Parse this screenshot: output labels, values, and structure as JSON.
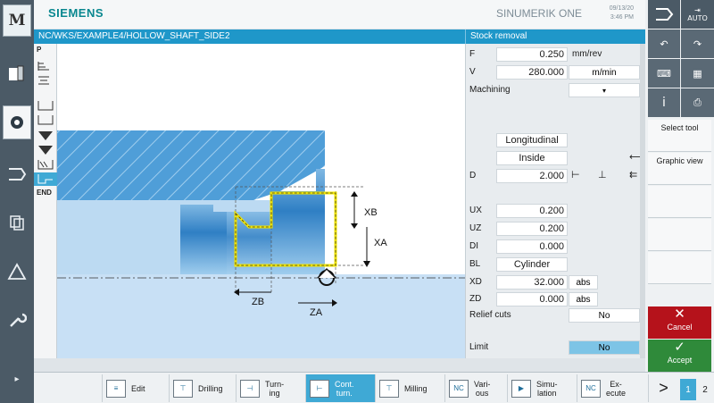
{
  "header": {
    "logo": "SIEMENS",
    "product": "SINUMERIK ONE",
    "date": "09/13/20",
    "time": "3:46 PM"
  },
  "path": "NC/WKS/EXAMPLE4/HOLLOW_SHAFT_SIDE2",
  "cycle_title": "Stock removal",
  "left_sidebar": {
    "m_label": "M"
  },
  "program_list": {
    "first": "P",
    "last": "END"
  },
  "graphic": {
    "labels": {
      "xb": "XB",
      "xa": "XA",
      "zb": "ZB",
      "za": "ZA"
    }
  },
  "form": {
    "f": {
      "label": "F",
      "value": "0.250",
      "unit": "mm/rev"
    },
    "v": {
      "label": "V",
      "value": "280.000",
      "unit": "m/min"
    },
    "machining": {
      "label": "Machining",
      "value": "▾"
    },
    "direction": {
      "value": "Longitudinal"
    },
    "position": {
      "value": "Inside"
    },
    "d": {
      "label": "D",
      "value": "2.000"
    },
    "ux": {
      "label": "UX",
      "value": "0.200"
    },
    "uz": {
      "label": "UZ",
      "value": "0.200"
    },
    "di": {
      "label": "DI",
      "value": "0.000"
    },
    "bl": {
      "label": "BL",
      "value": "Cylinder"
    },
    "xd": {
      "label": "XD",
      "value": "32.000",
      "unit": "abs"
    },
    "zd": {
      "label": "ZD",
      "value": "0.000",
      "unit": "abs"
    },
    "relief": {
      "label": "Relief cuts",
      "value": "No"
    },
    "limit": {
      "label": "Limit",
      "value": "No"
    }
  },
  "right_softkeys": {
    "auto": "AUTO",
    "select_tool": "Select tool",
    "graphic_view": "Graphic view",
    "cancel": "Cancel",
    "accept": "Accept"
  },
  "bottom_softkeys": {
    "edit": "Edit",
    "drilling": "Drilling",
    "turning": "Turn-\ning",
    "cont_turn": "Cont.\nturn.",
    "milling": "Milling",
    "various": "Vari-\nous",
    "simulation": "Simu-\nlation",
    "execute": "Ex-\necute",
    "nc_icon": "NC",
    "next": ">",
    "page1": "1",
    "page2": "2"
  },
  "colors": {
    "accent": "#1f97c9",
    "cancel": "#b5121b",
    "accept": "#2f8a3a",
    "contour": "#f2e600"
  }
}
